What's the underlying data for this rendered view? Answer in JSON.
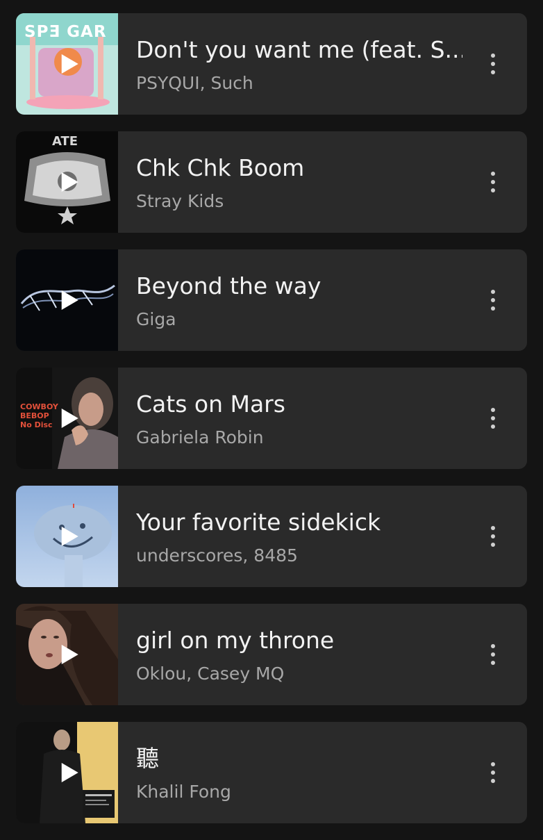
{
  "tracks": [
    {
      "title": "Don't you want me (feat. S...",
      "artist": "PSYQUI, Such",
      "cover_text": "SPƎ GAR"
    },
    {
      "title": "Chk Chk Boom",
      "artist": "Stray Kids",
      "cover_text": "ATE"
    },
    {
      "title": "Beyond the way",
      "artist": "Giga",
      "cover_text": ""
    },
    {
      "title": "Cats on Mars",
      "artist": "Gabriela Robin",
      "cover_text": "COWBOY BEBOP No Disc"
    },
    {
      "title": "Your favorite sidekick",
      "artist": "underscores, 8485",
      "cover_text": ""
    },
    {
      "title": "girl on my throne",
      "artist": "Oklou, Casey MQ",
      "cover_text": ""
    },
    {
      "title": "聽",
      "artist": "Khalil Fong",
      "cover_text": ""
    }
  ],
  "icons": {
    "play": "play-icon",
    "more": "more-vertical-icon"
  },
  "colors": {
    "background": "#141414",
    "card": "#2a2a2a",
    "title": "#f2f2f2",
    "artist": "#a8a8a8"
  }
}
